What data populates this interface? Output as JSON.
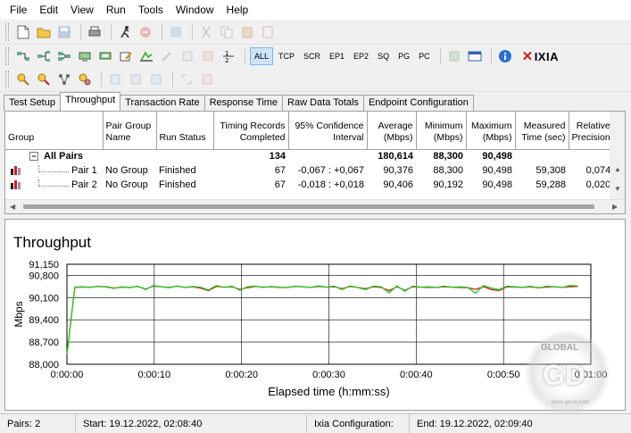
{
  "menu": [
    "File",
    "Edit",
    "View",
    "Run",
    "Tools",
    "Window",
    "Help"
  ],
  "toolbar": {
    "protocols": [
      "ALL",
      "TCP",
      "SCR",
      "EP1",
      "EP2",
      "SQ",
      "PG",
      "PC"
    ],
    "brand": "IXIA"
  },
  "tabs": [
    "Test Setup",
    "Throughput",
    "Transaction Rate",
    "Response Time",
    "Raw Data Totals",
    "Endpoint Configuration"
  ],
  "grid": {
    "headers": {
      "group": "Group",
      "pair_group_name": "Pair Group Name",
      "run_status": "Run Status",
      "timing_records": "Timing Records Completed",
      "confidence": "95% Confidence Interval",
      "average": "Average (Mbps)",
      "minimum": "Minimum (Mbps)",
      "maximum": "Maximum (Mbps)",
      "measured_time": "Measured Time (sec)",
      "relative_precision": "Relative Precision"
    },
    "summary": {
      "expander": "−",
      "group": "All Pairs",
      "timing_records": "134",
      "average": "180,614",
      "minimum": "88,300",
      "maximum": "90,498"
    },
    "rows": [
      {
        "group": "Pair 1",
        "pair_group_name": "No Group",
        "run_status": "Finished",
        "timing_records": "67",
        "confidence": "-0,067 : +0,067",
        "average": "90,376",
        "minimum": "88,300",
        "maximum": "90,498",
        "measured_time": "59,308",
        "relative_precision": "0,074"
      },
      {
        "group": "Pair 2",
        "pair_group_name": "No Group",
        "run_status": "Finished",
        "timing_records": "67",
        "confidence": "-0,018 : +0,018",
        "average": "90,406",
        "minimum": "90,192",
        "maximum": "90,498",
        "measured_time": "59,288",
        "relative_precision": "0,020"
      }
    ]
  },
  "chart_data": {
    "type": "line",
    "title": "Throughput",
    "xlabel": "Elapsed time (h:mm:ss)",
    "ylabel": "Mbps",
    "xlim": [
      0,
      60
    ],
    "ylim": [
      88000,
      91150
    ],
    "x_tick_labels": [
      "0:00:00",
      "0:00:10",
      "0:00:20",
      "0:00:30",
      "0:00:40",
      "0:00:50",
      "0:01:00"
    ],
    "y_tick_labels": [
      "91,150",
      "90,800",
      "90,100",
      "89,400",
      "88,700",
      "88,000"
    ],
    "y_ticks": [
      91150,
      90800,
      90100,
      89400,
      88700,
      88000
    ],
    "grid": true,
    "legend": "none",
    "series": [
      {
        "color": "#22cc22",
        "x": [
          0,
          0.9,
          1.8,
          2.7,
          3.6,
          4.5,
          5.4,
          6.3,
          7.2,
          8.1,
          9.0,
          9.9,
          10.8,
          11.7,
          12.6,
          13.5,
          14.4,
          15.3,
          16.2,
          17.1,
          18.0,
          18.9,
          19.8,
          20.7,
          21.6,
          22.5,
          23.4,
          24.3,
          25.2,
          26.1,
          27.0,
          27.9,
          28.8,
          29.7,
          30.6,
          31.5,
          32.4,
          33.3,
          34.2,
          35.1,
          36.0,
          36.9,
          37.8,
          38.7,
          39.6,
          40.5,
          41.4,
          42.3,
          43.2,
          44.1,
          45.0,
          45.9,
          46.8,
          47.7,
          48.6,
          49.5,
          50.4,
          51.3,
          52.2,
          53.1,
          54.0,
          54.9,
          55.8,
          56.7,
          57.6,
          58.5
        ],
        "y": [
          88300,
          90430,
          90440,
          90420,
          90460,
          90430,
          90390,
          90440,
          90410,
          90460,
          90350,
          90480,
          90440,
          90410,
          90470,
          90420,
          90450,
          90430,
          90340,
          90480,
          90420,
          90460,
          90330,
          90440,
          90460,
          90420,
          90450,
          90430,
          90410,
          90460,
          90440,
          90420,
          90470,
          90430,
          90460,
          90350,
          90470,
          90420,
          90350,
          90460,
          90440,
          90250,
          90470,
          90300,
          90460,
          90430,
          90440,
          90420,
          90460,
          90430,
          90440,
          90420,
          90240,
          90480,
          90400,
          90350,
          90460,
          90440,
          90420,
          90460,
          90400,
          90460,
          90440,
          90420,
          90480,
          90470
        ]
      },
      {
        "color": "#cc2222",
        "x": [
          0,
          0.9,
          1.8,
          2.7,
          3.6,
          4.5,
          5.4,
          6.3,
          7.2,
          8.1,
          9.0,
          9.9,
          10.8,
          11.7,
          12.6,
          13.5,
          14.4,
          15.3,
          16.2,
          17.1,
          18.0,
          18.9,
          19.8,
          20.7,
          21.6,
          22.5,
          23.4,
          24.3,
          25.2,
          26.1,
          27.0,
          27.9,
          28.8,
          29.7,
          30.6,
          31.5,
          32.4,
          33.3,
          34.2,
          35.1,
          36.0,
          36.9,
          37.8,
          38.7,
          39.6,
          40.5,
          41.4,
          42.3,
          43.2,
          44.1,
          45.0,
          45.9,
          46.8,
          47.7,
          48.6,
          49.5,
          50.4,
          51.3,
          52.2,
          53.1,
          54.0,
          54.9,
          55.8,
          56.7,
          57.6,
          58.5
        ],
        "y": [
          88300,
          90420,
          90430,
          90430,
          90450,
          90440,
          90400,
          90430,
          90420,
          90450,
          90370,
          90460,
          90440,
          90420,
          90460,
          90420,
          90440,
          90400,
          90320,
          90450,
          90430,
          90440,
          90360,
          90410,
          90450,
          90430,
          90440,
          90420,
          90420,
          90450,
          90440,
          90420,
          90450,
          90430,
          90440,
          90380,
          90450,
          90420,
          90380,
          90440,
          90420,
          90320,
          90440,
          90330,
          90440,
          90430,
          90420,
          90420,
          90440,
          90430,
          90420,
          90410,
          90360,
          90440,
          90350,
          90320,
          90440,
          90430,
          90420,
          90440,
          90410,
          90430,
          90440,
          90420,
          90440,
          90450
        ]
      }
    ]
  },
  "status": {
    "pairs": "Pairs: 2",
    "start": "Start: 19.12.2022, 02:08:40",
    "ixia_config": "Ixia Configuration:",
    "end": "End: 19.12.2022, 02:09:40"
  },
  "watermark": {
    "top": "GLOBAL",
    "big": "GD",
    "url": "www.gecid.com"
  }
}
